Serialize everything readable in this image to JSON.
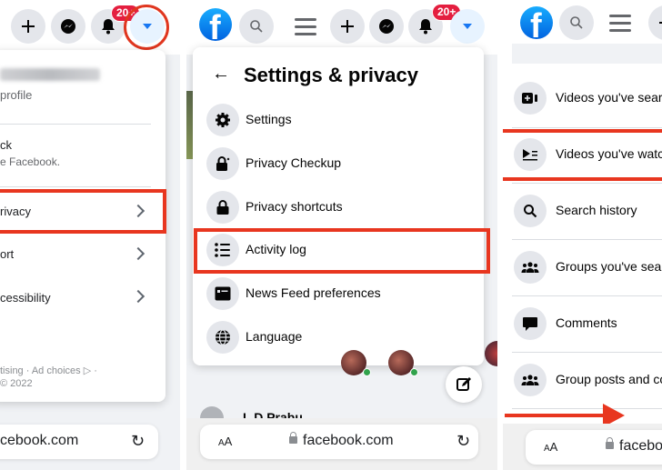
{
  "colors": {
    "accent": "#1877f2",
    "highlight": "#e8361f",
    "badge": "#e41e3f",
    "online": "#31a24c"
  },
  "nav": {
    "notification_badge": "20+",
    "icons": [
      "facebook-logo",
      "search-icon",
      "menu-icon",
      "plus-icon",
      "messenger-icon",
      "bell-icon",
      "dropdown-caret-icon"
    ]
  },
  "panel1": {
    "profile_subtitle": "profile",
    "feedback_title": "ck",
    "feedback_subtitle": "e Facebook.",
    "items": [
      {
        "label": "rivacy",
        "highlighted": true
      },
      {
        "label": "ort"
      },
      {
        "label": "cessibility"
      }
    ],
    "footer_line1": "tising · Ad choices ▷ ·",
    "footer_line2": "© 2022",
    "url": "cebook.com"
  },
  "panel2": {
    "title": "Settings & privacy",
    "items": [
      {
        "label": "Settings",
        "icon": "gear-icon"
      },
      {
        "label": "Privacy Checkup",
        "icon": "lock-heart-icon"
      },
      {
        "label": "Privacy shortcuts",
        "icon": "lock-icon"
      },
      {
        "label": "Activity log",
        "icon": "list-icon",
        "highlighted": true
      },
      {
        "label": "News Feed preferences",
        "icon": "feed-icon"
      },
      {
        "label": "Language",
        "icon": "globe-icon"
      }
    ],
    "behind_text": "L D Prabu",
    "aa_label": "AA",
    "url": "facebook.com"
  },
  "panel3": {
    "items": [
      {
        "label": "Videos you've searched for",
        "icon": "video-add-icon"
      },
      {
        "label": "Videos you've watched",
        "icon": "video-list-icon",
        "highlighted": true
      },
      {
        "label": "Search history",
        "icon": "search-icon"
      },
      {
        "label": "Groups you've searched for",
        "icon": "groups-icon"
      },
      {
        "label": "Comments",
        "icon": "comment-icon"
      },
      {
        "label": "Group posts and comments",
        "icon": "groups-icon"
      }
    ],
    "aa_label": "AA",
    "url": "facebook.com"
  }
}
